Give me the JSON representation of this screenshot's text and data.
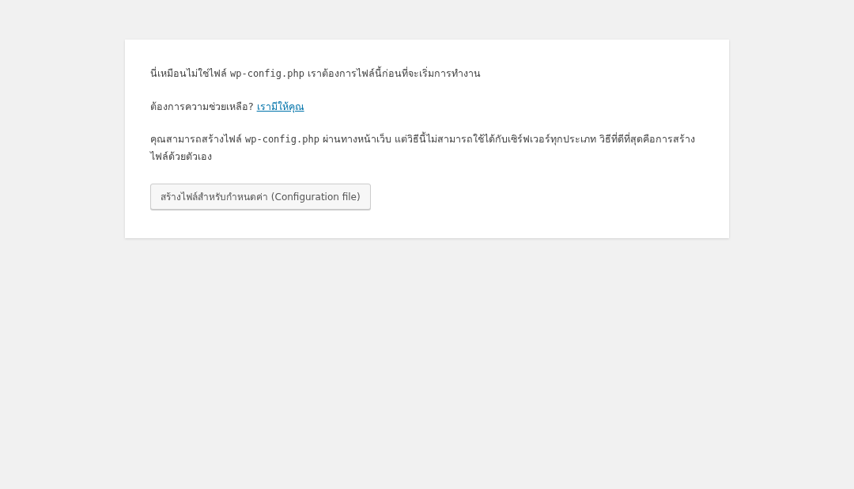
{
  "paragraphs": [
    {
      "parts": [
        {
          "kind": "text",
          "text": "นี่เหมือนไม่ใช่ไฟล์ "
        },
        {
          "kind": "code",
          "text": "wp-config.php"
        },
        {
          "kind": "text",
          "text": " เราต้องการไฟล์นี้ก่อนที่จะเริ่มการทำงาน"
        }
      ]
    },
    {
      "parts": [
        {
          "kind": "text",
          "text": "ต้องการความช่วยเหลือ? "
        },
        {
          "kind": "link",
          "text": "เรามีให้คุณ"
        }
      ]
    },
    {
      "parts": [
        {
          "kind": "text",
          "text": "คุณสามารถสร้างไฟล์ "
        },
        {
          "kind": "code",
          "text": "wp-config.php"
        },
        {
          "kind": "text",
          "text": " ผ่านทางหน้าเว็บ แต่วิธีนี้ไม่สามารถใช้ได้กับเซิร์ฟเวอร์ทุกประเภท วิธีที่ดีที่สุดคือการสร้างไฟล์ด้วยตัวเอง"
        }
      ]
    }
  ],
  "button": {
    "label": "สร้างไฟล์สำหรับกำหนดค่า (Configuration file)"
  }
}
